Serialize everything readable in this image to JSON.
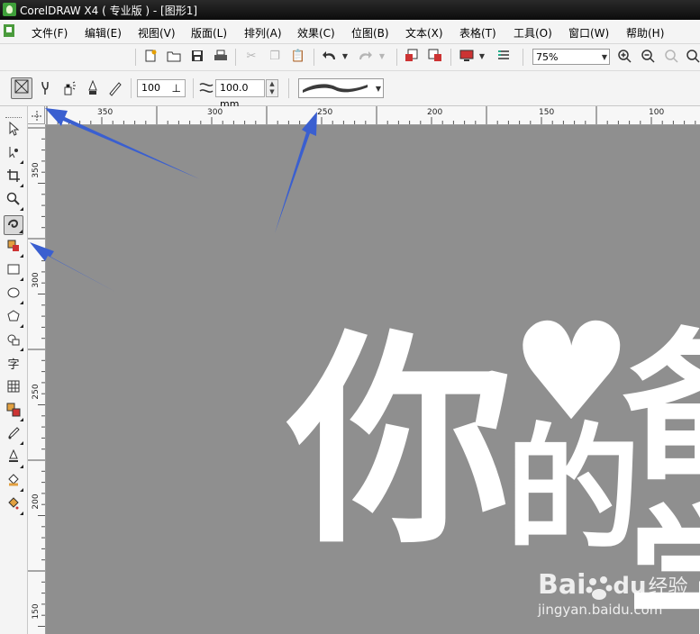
{
  "window": {
    "title": "CorelDRAW X4 ( 专业版 ) - [图形1]"
  },
  "menu": [
    "文件(F)",
    "编辑(E)",
    "视图(V)",
    "版面(L)",
    "排列(A)",
    "效果(C)",
    "位图(B)",
    "文本(X)",
    "表格(T)",
    "工具(O)",
    "窗口(W)",
    "帮助(H)"
  ],
  "standard_toolbar": {
    "zoom_level": "75%"
  },
  "property_bar": {
    "smoothing_value": "100",
    "stroke_width": "100.0 mm"
  },
  "rulers": {
    "horizontal": [
      "350",
      "300",
      "250",
      "200",
      "150",
      "100"
    ],
    "vertical": [
      "350",
      "300",
      "250",
      "200",
      "150"
    ]
  },
  "canvas_art": {
    "char1": "你",
    "heart": "♥",
    "char2": "的",
    "char3": "备",
    "char4": "学"
  },
  "watermark": {
    "brand": "Bai",
    "paw": "du",
    "cn": "经验",
    "url": "jingyan.baidu.com"
  },
  "colors": {
    "canvas_bg": "#8f8f8f",
    "annotation_arrow": "#3a5fd0",
    "art_text": "#ffffff"
  }
}
